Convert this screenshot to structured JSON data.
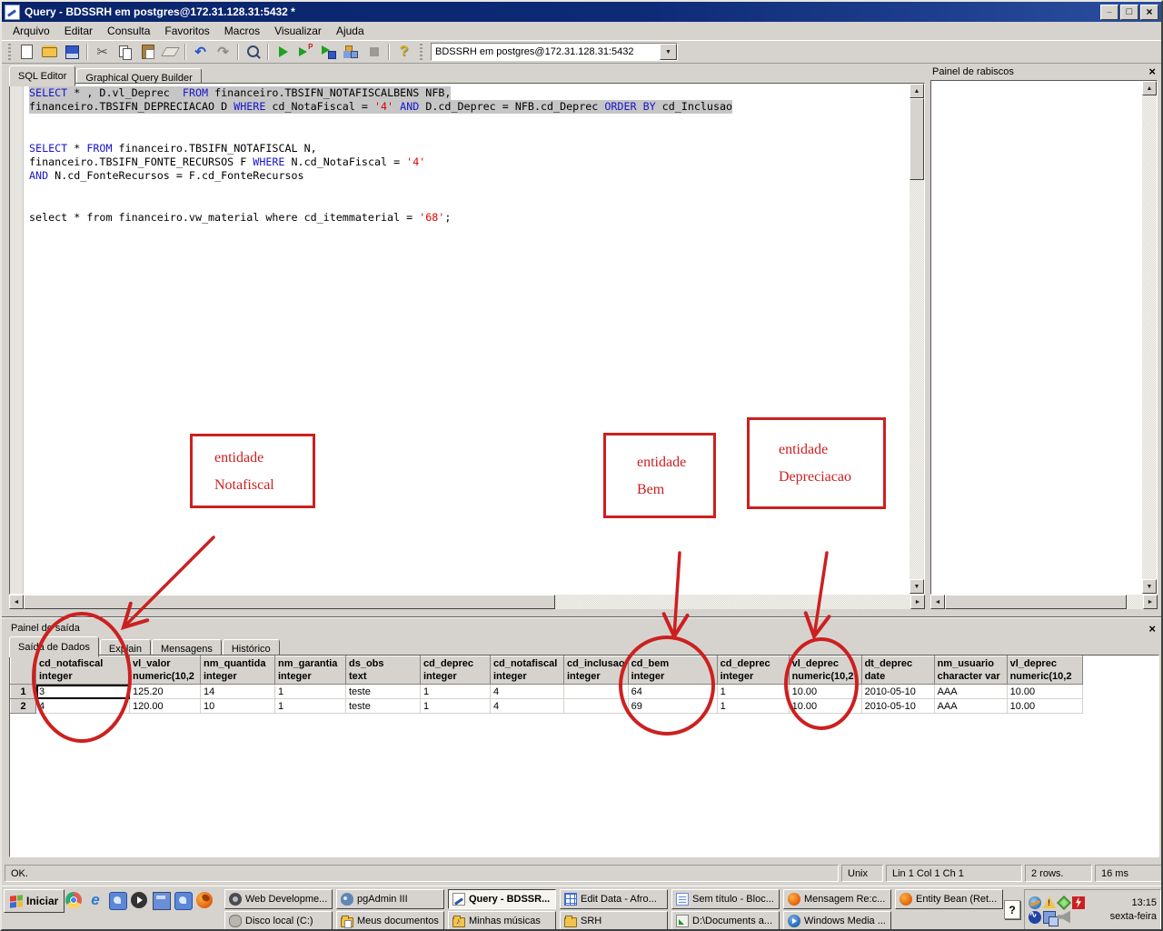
{
  "window": {
    "title": "Query - BDSSRH em postgres@172.31.128.31:5432 *",
    "menu": [
      "Arquivo",
      "Editar",
      "Consulta",
      "Favoritos",
      "Macros",
      "Visualizar",
      "Ajuda"
    ],
    "toolbar": [
      "new-file",
      "open",
      "save",
      "sep",
      "cut",
      "copy",
      "paste",
      "clear",
      "sep",
      "undo",
      "redo",
      "sep",
      "find",
      "sep",
      "execute",
      "explain",
      "execute-to-file",
      "macros",
      "cancel",
      "sep",
      "help"
    ],
    "window_buttons": [
      "minimize",
      "maximize",
      "close"
    ],
    "connection": "BDSSRH em postgres@172.31.128.31:5432"
  },
  "editor": {
    "tabs": [
      {
        "label": "SQL Editor",
        "active": true
      },
      {
        "label": "Graphical Query Builder",
        "active": false
      }
    ],
    "sql_lines": [
      {
        "selected": true,
        "segs": [
          [
            "k",
            "SELECT"
          ],
          [
            "p",
            " * , D.vl_Deprec  "
          ],
          [
            "k",
            "FROM"
          ],
          [
            "p",
            " financeiro.TBSIFN_NOTAFISCALBENS NFB,"
          ]
        ]
      },
      {
        "selected": true,
        "segs": [
          [
            "p",
            "financeiro.TBSIFN_DEPRECIACAO D "
          ],
          [
            "k",
            "WHERE"
          ],
          [
            "p",
            " cd_NotaFiscal = "
          ],
          [
            "s",
            "'4'"
          ],
          [
            "p",
            " "
          ],
          [
            "k",
            "AND"
          ],
          [
            "p",
            " D.cd_Deprec = NFB.cd_Deprec "
          ],
          [
            "k",
            "ORDER BY"
          ],
          [
            "p",
            " cd_Inclusao"
          ]
        ]
      },
      {
        "segs": []
      },
      {
        "segs": []
      },
      {
        "segs": [
          [
            "k",
            "SELECT"
          ],
          [
            "p",
            " * "
          ],
          [
            "k",
            "FROM"
          ],
          [
            "p",
            " financeiro.TBSIFN_NOTAFISCAL N,"
          ]
        ]
      },
      {
        "segs": [
          [
            "p",
            "financeiro.TBSIFN_FONTE_RECURSOS F "
          ],
          [
            "k",
            "WHERE"
          ],
          [
            "p",
            " N.cd_NotaFiscal = "
          ],
          [
            "s",
            "'4'"
          ]
        ]
      },
      {
        "segs": [
          [
            "k",
            "AND"
          ],
          [
            "p",
            " N.cd_FonteRecursos = F.cd_FonteRecursos"
          ]
        ]
      },
      {
        "segs": []
      },
      {
        "segs": []
      },
      {
        "segs": [
          [
            "p",
            "select * from financeiro.vw_material where cd_itemmaterial = "
          ],
          [
            "s",
            "'68'"
          ],
          [
            "p",
            ";"
          ]
        ]
      }
    ]
  },
  "scratch_panel": {
    "title": "Painel de rabiscos",
    "close_glyph": "×"
  },
  "output_panel": {
    "title": "Painel de saída",
    "close_glyph": "×",
    "tabs": [
      {
        "label": "Saída de Dados",
        "active": true
      },
      {
        "label": "Explain",
        "active": false
      },
      {
        "label": "Mensagens",
        "active": false
      },
      {
        "label": "Histórico",
        "active": false
      }
    ],
    "grid": {
      "columns": [
        {
          "name": "cd_notafiscal",
          "type": "integer"
        },
        {
          "name": "vl_valor",
          "type": "numeric(10,2"
        },
        {
          "name": "nm_quantida",
          "type": "integer"
        },
        {
          "name": "nm_garantia",
          "type": "integer"
        },
        {
          "name": "ds_obs",
          "type": "text"
        },
        {
          "name": "cd_deprec",
          "type": "integer"
        },
        {
          "name": "cd_notafiscal",
          "type": "integer"
        },
        {
          "name": "cd_inclusao",
          "type": "integer"
        },
        {
          "name": "cd_bem",
          "type": "integer"
        },
        {
          "name": "cd_deprec",
          "type": "integer"
        },
        {
          "name": "vl_deprec",
          "type": "numeric(10,2"
        },
        {
          "name": "dt_deprec",
          "type": "date"
        },
        {
          "name": "nm_usuario",
          "type": "character var"
        },
        {
          "name": "vl_deprec",
          "type": "numeric(10,2"
        }
      ],
      "row_numbers": [
        "1",
        "2"
      ],
      "rows": [
        [
          "3",
          "125.20",
          "14",
          "1",
          "teste",
          "1",
          "4",
          "",
          "64",
          "1",
          "10.00",
          "2010-05-10",
          "AAA",
          "10.00"
        ],
        [
          "4",
          "120.00",
          "10",
          "1",
          "teste",
          "1",
          "4",
          "",
          "69",
          "1",
          "10.00",
          "2010-05-10",
          "AAA",
          "10.00"
        ]
      ],
      "selected_cell": {
        "row": 0,
        "col": 0
      }
    }
  },
  "annotations": {
    "color": "#cc2020",
    "boxes": [
      {
        "line1": "entidade",
        "line2": "Notafiscal"
      },
      {
        "line1": "entidade",
        "line2": "Bem"
      },
      {
        "line1": "entidade",
        "line2": "Depreciacao"
      }
    ]
  },
  "status_bar": {
    "message": "OK.",
    "mode": "Unix",
    "caret": "Lin 1 Col 1 Ch 1",
    "row_count": "2 rows.",
    "elapsed": "16 ms"
  },
  "taskbar": {
    "start_label": "Iniciar",
    "quick_launch": [
      "chrome",
      "internet-explorer",
      "messenger",
      "media-player",
      "virtualbox",
      "messenger",
      "firefox"
    ],
    "buttons_row1": [
      {
        "label": "Web Developme...",
        "icon": "gear"
      },
      {
        "label": "pgAdmin III",
        "icon": "pgadmin"
      },
      {
        "label": "Query - BDSSR...",
        "icon": "query",
        "active": true
      },
      {
        "label": "Edit Data - Afro...",
        "icon": "table"
      },
      {
        "label": "Sem título - Bloc...",
        "icon": "notepad"
      },
      {
        "label": "Mensagem Re:c...",
        "icon": "firefox"
      },
      {
        "label": "Entity Bean (Ret...",
        "icon": "firefox"
      }
    ],
    "buttons_row2": [
      {
        "label": "Disco local (C:)",
        "icon": "disk"
      },
      {
        "label": "Meus documentos",
        "icon": "folder-doc"
      },
      {
        "label": "Minhas músicas",
        "icon": "folder-music"
      },
      {
        "label": "SRH",
        "icon": "folder"
      },
      {
        "label": "D:\\Documents a...",
        "icon": "shortcut"
      },
      {
        "label": "Windows Media ...",
        "icon": "wmp"
      }
    ],
    "tray_icons_row1": [
      "globe",
      "warning",
      "cube",
      "lightning"
    ],
    "tray_icons_row2": [
      "wave",
      "network",
      "speaker"
    ],
    "help_glyph": "?",
    "clock": "13:15",
    "day": "sexta-feira"
  }
}
